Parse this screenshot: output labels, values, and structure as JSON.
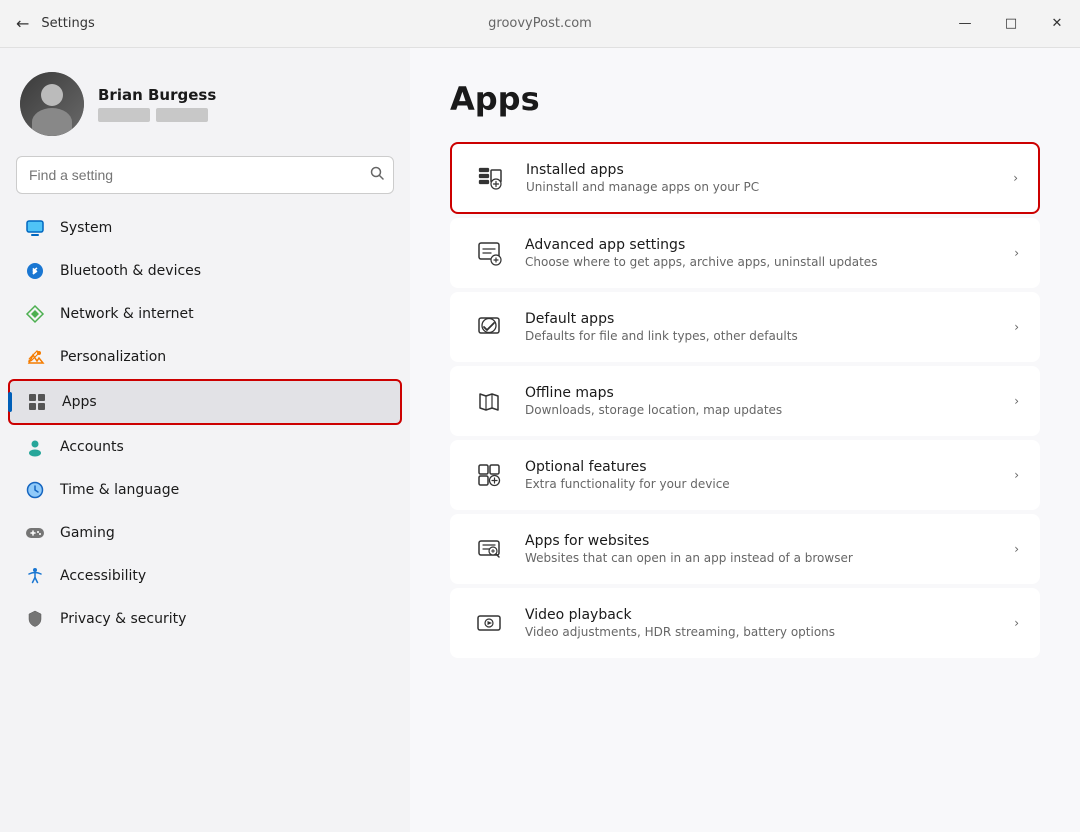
{
  "titlebar": {
    "back_label": "←",
    "title": "Settings",
    "center_text": "groovyPost.com",
    "btn_minimize": "—",
    "btn_maximize": "□",
    "btn_close": "✕"
  },
  "sidebar": {
    "profile": {
      "name": "Brian Burgess"
    },
    "search": {
      "placeholder": "Find a setting"
    },
    "nav_items": [
      {
        "id": "system",
        "label": "System",
        "icon": "system"
      },
      {
        "id": "bluetooth",
        "label": "Bluetooth & devices",
        "icon": "bluetooth"
      },
      {
        "id": "network",
        "label": "Network & internet",
        "icon": "network"
      },
      {
        "id": "personalization",
        "label": "Personalization",
        "icon": "personalization"
      },
      {
        "id": "apps",
        "label": "Apps",
        "icon": "apps",
        "active": true
      },
      {
        "id": "accounts",
        "label": "Accounts",
        "icon": "accounts"
      },
      {
        "id": "time",
        "label": "Time & language",
        "icon": "time"
      },
      {
        "id": "gaming",
        "label": "Gaming",
        "icon": "gaming"
      },
      {
        "id": "accessibility",
        "label": "Accessibility",
        "icon": "accessibility"
      },
      {
        "id": "privacy",
        "label": "Privacy & security",
        "icon": "privacy"
      }
    ]
  },
  "main": {
    "title": "Apps",
    "items": [
      {
        "id": "installed-apps",
        "title": "Installed apps",
        "desc": "Uninstall and manage apps on your PC",
        "highlighted": true
      },
      {
        "id": "advanced-app-settings",
        "title": "Advanced app settings",
        "desc": "Choose where to get apps, archive apps, uninstall updates",
        "highlighted": false
      },
      {
        "id": "default-apps",
        "title": "Default apps",
        "desc": "Defaults for file and link types, other defaults",
        "highlighted": false
      },
      {
        "id": "offline-maps",
        "title": "Offline maps",
        "desc": "Downloads, storage location, map updates",
        "highlighted": false
      },
      {
        "id": "optional-features",
        "title": "Optional features",
        "desc": "Extra functionality for your device",
        "highlighted": false
      },
      {
        "id": "apps-for-websites",
        "title": "Apps for websites",
        "desc": "Websites that can open in an app instead of a browser",
        "highlighted": false
      },
      {
        "id": "video-playback",
        "title": "Video playback",
        "desc": "Video adjustments, HDR streaming, battery options",
        "highlighted": false
      }
    ]
  }
}
